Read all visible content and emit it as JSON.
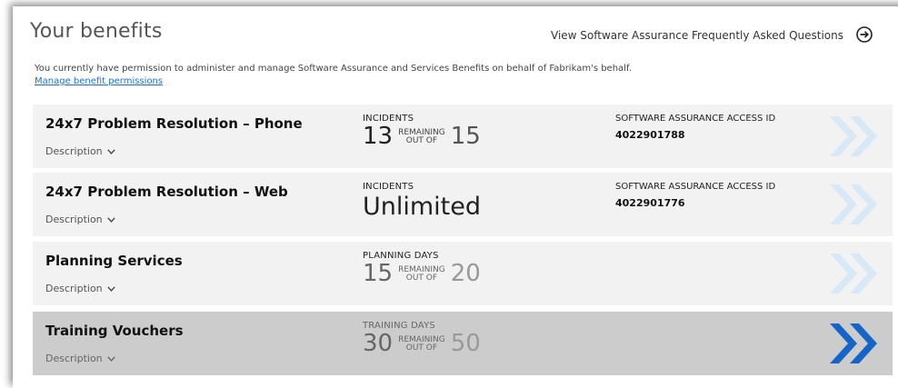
{
  "header": {
    "title": "Your benefits",
    "faq_link": "View Software Assurance Frequently Asked Questions",
    "intro": "You currently have permission to administer and manage Software Assurance and Services Benefits on behalf of Fabrikam's behalf.",
    "permissions_link": "Manage benefit permissions"
  },
  "colors": {
    "chevron_inactive": "#d7e8f6",
    "chevron_active": "#1565c8",
    "active_card": "#cccccc",
    "card": "#f2f2f2"
  },
  "benefits": [
    {
      "title": "24x7 Problem Resolution – Phone",
      "description": "Description",
      "metric_label": "INCIDENTS",
      "remaining": "13",
      "remaining_label": "REMAINING",
      "outof_label": "OUT OF",
      "total": "15",
      "access_label": "SOFTWARE ASSURANCE ACCESS ID",
      "access_id": "4022901788"
    },
    {
      "title": "24x7 Problem Resolution – Web",
      "description": "Description",
      "metric_label": "INCIDENTS",
      "value": "Unlimited",
      "access_label": "SOFTWARE ASSURANCE ACCESS ID",
      "access_id": "4022901776"
    },
    {
      "title": "Planning Services",
      "description": "Description",
      "metric_label": "PLANNING DAYS",
      "remaining": "15",
      "remaining_label": "REMAINING",
      "outof_label": "OUT OF",
      "total": "20"
    },
    {
      "title": "Training Vouchers",
      "description": "Description",
      "metric_label": "TRAINING DAYS",
      "remaining": "30",
      "remaining_label": "REMAINING",
      "outof_label": "OUT OF",
      "total": "50",
      "selected": true
    }
  ]
}
